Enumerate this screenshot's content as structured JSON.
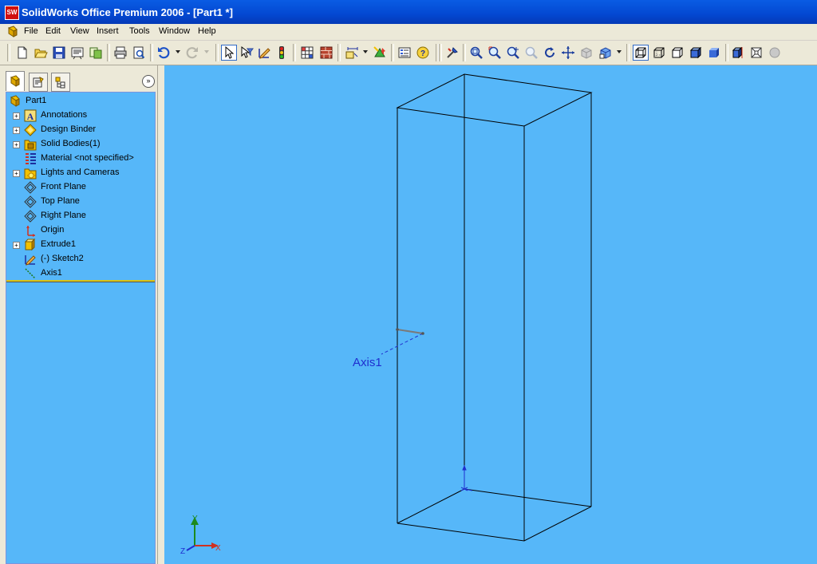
{
  "window": {
    "title": "SolidWorks Office Premium 2006 - [Part1 *]"
  },
  "menu": [
    "File",
    "Edit",
    "View",
    "Insert",
    "Tools",
    "Window",
    "Help"
  ],
  "toolbar_icons": [
    "new-icon",
    "open-icon",
    "save-icon",
    "print-preview-icon",
    "properties-icon",
    "print-icon",
    "preview-icon",
    "undo-icon",
    "redo-icon",
    "select-icon",
    "select-filter-icon",
    "sketch-icon",
    "traffic-light-icon",
    "grid-icon",
    "brick-wall-icon",
    "smart-dimension-icon",
    "rebuild-icon",
    "options-icon",
    "help-icon",
    "tool-icon",
    "zoom-fit-icon",
    "zoom-area-icon",
    "zoom-in-out-icon",
    "zoom-selection-icon",
    "rotate-icon",
    "pan-icon",
    "view-orientation-icon",
    "3d-view-icon",
    "wireframe-icon",
    "hidden-lines-visible-icon",
    "hidden-lines-removed-icon",
    "shaded-icon",
    "shaded-edges-icon",
    "section-view-icon",
    "perspective-icon",
    "sphere-icon"
  ],
  "panel": {
    "tabs": [
      "feature-manager-icon",
      "property-manager-icon",
      "configuration-manager-icon"
    ],
    "tree": [
      {
        "label": "Part1",
        "icon": "part-icon",
        "expandable": false,
        "root": true
      },
      {
        "label": "Annotations",
        "icon": "annotations-icon",
        "expandable": true
      },
      {
        "label": "Design Binder",
        "icon": "design-binder-icon",
        "expandable": true
      },
      {
        "label": "Solid Bodies(1)",
        "icon": "solid-bodies-icon",
        "expandable": true
      },
      {
        "label": "Material <not specified>",
        "icon": "material-icon",
        "expandable": false
      },
      {
        "label": "Lights and Cameras",
        "icon": "lights-icon",
        "expandable": true
      },
      {
        "label": "Front Plane",
        "icon": "plane-icon",
        "expandable": false
      },
      {
        "label": "Top Plane",
        "icon": "plane-icon",
        "expandable": false
      },
      {
        "label": "Right Plane",
        "icon": "plane-icon",
        "expandable": false
      },
      {
        "label": "Origin",
        "icon": "origin-icon",
        "expandable": false
      },
      {
        "label": "Extrude1",
        "icon": "extrude-icon",
        "expandable": true
      },
      {
        "label": "(-) Sketch2",
        "icon": "sketch-icon",
        "expandable": false
      },
      {
        "label": "Axis1",
        "icon": "axis-icon",
        "expandable": false
      }
    ]
  },
  "viewport": {
    "axis_label": "Axis1",
    "triad": {
      "x": "X",
      "y": "Y",
      "z": "Z"
    },
    "colors": {
      "background": "#56b7f9",
      "edge": "#000000",
      "axis": "#1f2fcf"
    }
  }
}
